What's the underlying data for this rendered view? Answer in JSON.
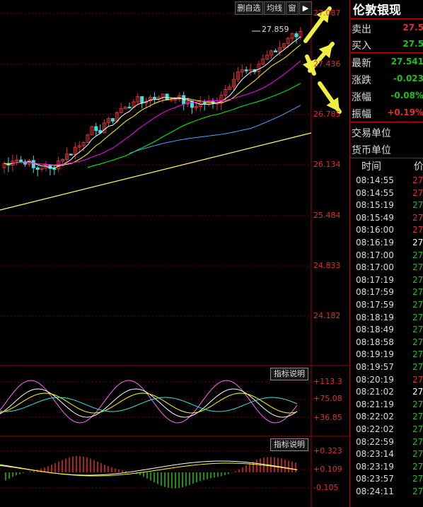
{
  "toolbar": {
    "btn_watchlist": "删自选",
    "btn_ma": "均线",
    "btn_window": "窗",
    "btn_arrow": "▶"
  },
  "price_axis": [
    "27.087",
    "27.436",
    "26.785",
    "26.134",
    "25.484",
    "24.833",
    "24.182"
  ],
  "high_marker": "27.859",
  "indicator1": {
    "button": "指标说明",
    "labels": [
      "+113.3",
      "+75.08",
      "+36.85"
    ]
  },
  "indicator2": {
    "button": "指标说明",
    "labels": [
      "+0.323",
      "+0.109",
      "-0.105"
    ]
  },
  "panel": {
    "title": "伦敦银现",
    "sell_label": "卖出",
    "sell_value": "27.5",
    "buy_label": "买入",
    "buy_value": "27.5",
    "last_label": "最新",
    "last_value": "27.541",
    "change_label": "涨跌",
    "change_value": "-0.023",
    "pct_label": "涨幅",
    "pct_value": "-0.08%",
    "amp_label": "振幅",
    "amp_value": "+0.19%",
    "unit_label": "交易单位",
    "currency_label": "货币单位",
    "col_time": "时间",
    "col_price": "价"
  },
  "ticks": [
    {
      "time": "08:14:55",
      "price": "27",
      "color": "#e03030"
    },
    {
      "time": "08:14:55",
      "price": "27",
      "color": "#e03030"
    },
    {
      "time": "08:15:19",
      "price": "27",
      "color": "#20c020"
    },
    {
      "time": "08:15:49",
      "price": "27",
      "color": "#e03030"
    },
    {
      "time": "08:16:00",
      "price": "27",
      "color": "#e03030"
    },
    {
      "time": "08:16:19",
      "price": "27",
      "color": "#ffffff"
    },
    {
      "time": "08:17:00",
      "price": "27",
      "color": "#20c020"
    },
    {
      "time": "08:17:00",
      "price": "27",
      "color": "#20c020"
    },
    {
      "time": "08:17:19",
      "price": "27",
      "color": "#20c020"
    },
    {
      "time": "08:17:59",
      "price": "27",
      "color": "#20c020"
    },
    {
      "time": "08:17:59",
      "price": "27",
      "color": "#20c020"
    },
    {
      "time": "08:18:19",
      "price": "27",
      "color": "#20c020"
    },
    {
      "time": "08:18:49",
      "price": "27",
      "color": "#20c020"
    },
    {
      "time": "08:18:58",
      "price": "27",
      "color": "#20c020"
    },
    {
      "time": "08:19:19",
      "price": "27",
      "color": "#20c020"
    },
    {
      "time": "08:19:57",
      "price": "27",
      "color": "#20c020"
    },
    {
      "time": "08:20:19",
      "price": "27",
      "color": "#e03030"
    },
    {
      "time": "08:21:02",
      "price": "27",
      "color": "#ffffff"
    },
    {
      "time": "08:21:19",
      "price": "27",
      "color": "#20c020"
    },
    {
      "time": "08:22:02",
      "price": "27",
      "color": "#20c020"
    },
    {
      "time": "08:22:02",
      "price": "27",
      "color": "#20c020"
    },
    {
      "time": "08:22:59",
      "price": "27",
      "color": "#20c020"
    },
    {
      "time": "08:23:14",
      "price": "27",
      "color": "#20c020"
    },
    {
      "time": "08:23:19",
      "price": "27",
      "color": "#20c020"
    },
    {
      "time": "08:23:57",
      "price": "27",
      "color": "#20c020"
    },
    {
      "time": "08:24:11",
      "price": "27",
      "color": "#20c020"
    }
  ],
  "colors": {
    "up": "#e03030",
    "down": "#40e0e0",
    "grid": "#7a0000",
    "ma5": "#ffffff",
    "ma10": "#ffff00",
    "ma20": "#ff00ff",
    "ma60": "#00ff00",
    "trendline": "#ffff66",
    "arrow": "#f0f040"
  }
}
